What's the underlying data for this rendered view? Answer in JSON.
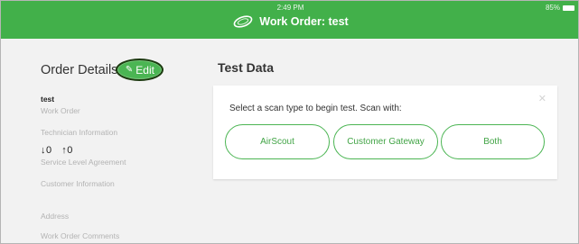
{
  "status_bar": {
    "time": "2:49 PM",
    "battery": "85%"
  },
  "header": {
    "title": "Work Order: test",
    "logo_icon": "swirl-logo-icon",
    "color": "#42b04a"
  },
  "order_details": {
    "title": "Order Details",
    "edit_label": "Edit",
    "work_order_value": "test",
    "work_order_label": "Work Order",
    "technician_label": "Technician Information",
    "sla_down": "↓0",
    "sla_up": "↑0",
    "sla_label": "Service Level Agreement",
    "customer_label": "Customer Information",
    "address_label": "Address",
    "comments_label": "Work Order Comments"
  },
  "test_data": {
    "title": "Test Data",
    "prompt": "Select a scan type to begin test. Scan with:",
    "close_icon": "close-icon",
    "buttons": [
      "AirScout",
      "Customer Gateway",
      "Both"
    ]
  }
}
